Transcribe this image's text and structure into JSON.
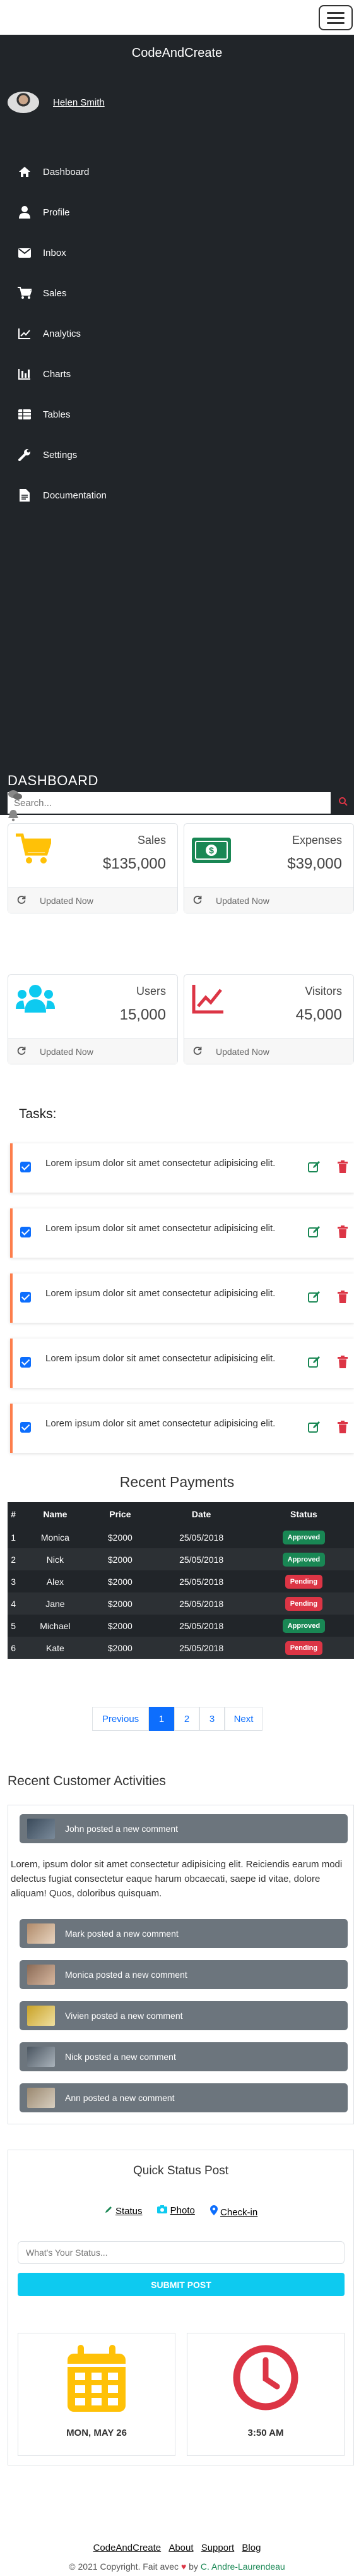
{
  "brand": "CodeAndCreate",
  "user": {
    "name": "Helen Smith"
  },
  "menu": [
    {
      "label": "Dashboard",
      "icon": "home-icon"
    },
    {
      "label": "Profile",
      "icon": "user-icon"
    },
    {
      "label": "Inbox",
      "icon": "envelope-icon"
    },
    {
      "label": "Sales",
      "icon": "cart-icon"
    },
    {
      "label": "Analytics",
      "icon": "line-chart-icon"
    },
    {
      "label": "Charts",
      "icon": "bar-chart-icon"
    },
    {
      "label": "Tables",
      "icon": "table-icon"
    },
    {
      "label": "Settings",
      "icon": "wrench-icon"
    },
    {
      "label": "Documentation",
      "icon": "file-icon"
    }
  ],
  "dashboard": {
    "title": "DASHBOARD",
    "search_placeholder": "Search..."
  },
  "cards": [
    {
      "label": "Sales",
      "value": "$135,000",
      "footer": "Updated Now",
      "icon": "cart-icon",
      "color": "#ffc107"
    },
    {
      "label": "Expenses",
      "value": "$39,000",
      "footer": "Updated Now",
      "icon": "money-icon",
      "color": "#198754"
    },
    {
      "label": "Users",
      "value": "15,000",
      "footer": "Updated Now",
      "icon": "users-icon",
      "color": "#0dcaf0"
    },
    {
      "label": "Visitors",
      "value": "45,000",
      "footer": "Updated Now",
      "icon": "chart-line-icon",
      "color": "#dc3545"
    }
  ],
  "tasks": {
    "title": "Tasks:",
    "items": [
      "Lorem ipsum dolor sit amet consectetur adipisicing elit.",
      "Lorem ipsum dolor sit amet consectetur adipisicing elit.",
      "Lorem ipsum dolor sit amet consectetur adipisicing elit.",
      "Lorem ipsum dolor sit amet consectetur adipisicing elit.",
      "Lorem ipsum dolor sit amet consectetur adipisicing elit."
    ]
  },
  "payments": {
    "title": "Recent Payments",
    "headers": [
      "#",
      "Name",
      "Price",
      "Date",
      "Status"
    ],
    "rows": [
      {
        "n": "1",
        "name": "Monica",
        "price": "$2000",
        "date": "25/05/2018",
        "status": "Approved"
      },
      {
        "n": "2",
        "name": "Nick",
        "price": "$2000",
        "date": "25/05/2018",
        "status": "Approved"
      },
      {
        "n": "3",
        "name": "Alex",
        "price": "$2000",
        "date": "25/05/2018",
        "status": "Pending"
      },
      {
        "n": "4",
        "name": "Jane",
        "price": "$2000",
        "date": "25/05/2018",
        "status": "Pending"
      },
      {
        "n": "5",
        "name": "Michael",
        "price": "$2000",
        "date": "25/05/2018",
        "status": "Approved"
      },
      {
        "n": "6",
        "name": "Kate",
        "price": "$2000",
        "date": "25/05/2018",
        "status": "Pending"
      }
    ],
    "status_colors": {
      "Approved": "#198754",
      "Pending": "#dc3545"
    },
    "pagination": [
      "Previous",
      "1",
      "2",
      "3",
      "Next"
    ],
    "active_page": "1"
  },
  "activities": {
    "title": "Recent Customer Activities",
    "first": "John posted a new comment",
    "paragraph": "Lorem, ipsum dolor sit amet consectetur adipisicing elit. Reiciendis earum modi delectus fugiat consectetur eaque harum obcaecati, saepe id vitae, dolore aliquam! Quos, doloribus quisquam.",
    "items": [
      "Mark posted a new comment",
      "Monica posted a new comment",
      "Vivien posted a new comment",
      "Nick posted a new comment",
      "Ann posted a new comment"
    ]
  },
  "quick_post": {
    "title": "Quick Status Post",
    "links": [
      "Status",
      "Photo",
      "Check-in"
    ],
    "input_placeholder": "What's Your Status...",
    "button": "SUBMIT POST",
    "date_label": "MON, MAY 26",
    "time_label": "3:50 AM"
  },
  "footer": {
    "links": [
      "CodeAndCreate",
      "About",
      "Support",
      "Blog"
    ],
    "copyright": "© 2021 Copyright. Fait avec",
    "by": "by",
    "author": "C. Andre-Laurendeau"
  }
}
